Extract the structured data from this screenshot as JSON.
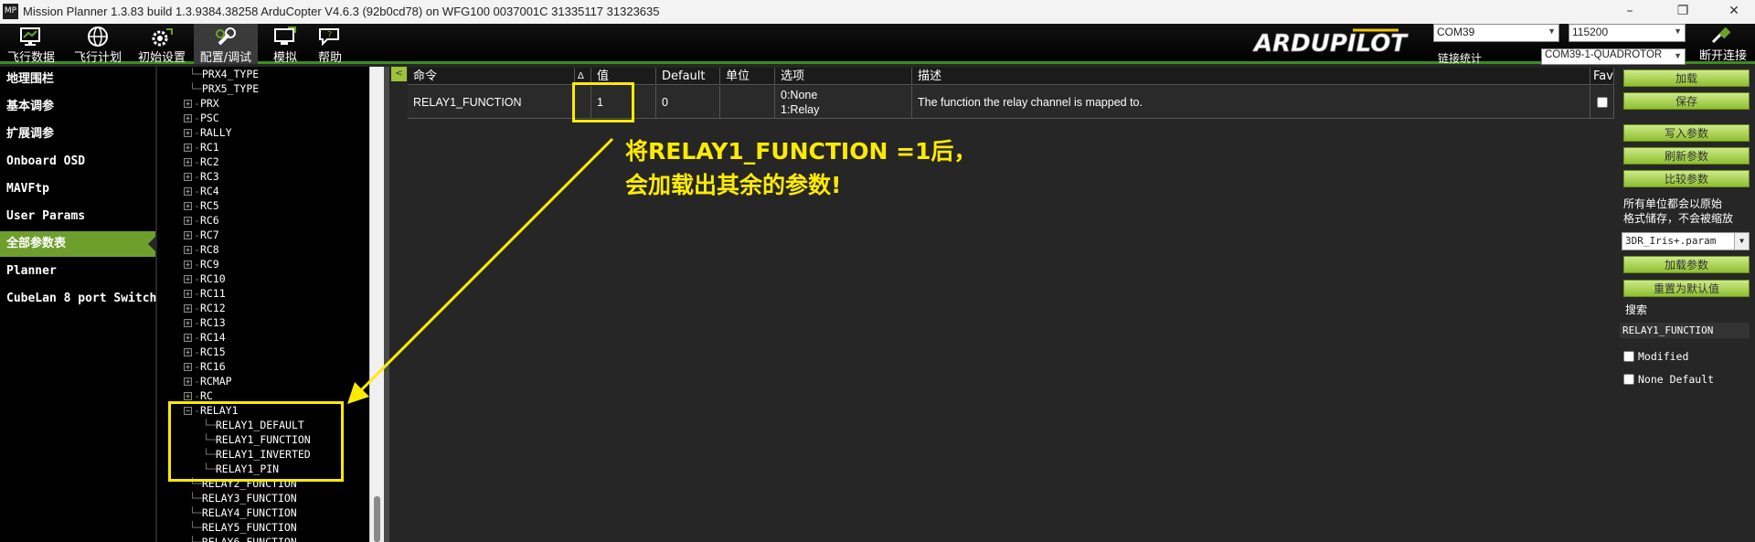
{
  "window": {
    "title": "Mission Planner 1.3.83 build 1.3.9384.38258 ArduCopter V4.6.3 (92b0cd78) on WFG100 0037001C 31335117 31323635",
    "minimize": "–",
    "maximize": "❐",
    "close": "✕"
  },
  "toolbar": {
    "buttons": [
      {
        "label": "飞行数据"
      },
      {
        "label": "飞行计划"
      },
      {
        "label": "初始设置"
      },
      {
        "label": "配置/调试"
      },
      {
        "label": "模拟"
      },
      {
        "label": "帮助"
      }
    ],
    "logo": "ARDUPILOT",
    "port": "COM39",
    "baud": "115200",
    "link_stats": "链接统计",
    "vehicle": "COM39-1-QUADROTOR",
    "disconnect": "断开连接"
  },
  "colors": {
    "accent": "#6e9e2b",
    "annotation": "#ffeb00"
  },
  "sidebar": {
    "items": [
      {
        "label": "地理围栏"
      },
      {
        "label": "基本调参"
      },
      {
        "label": "扩展调参"
      },
      {
        "label": "Onboard OSD"
      },
      {
        "label": "MAVFtp"
      },
      {
        "label": "User Params"
      },
      {
        "label": "全部参数表"
      },
      {
        "label": "Planner"
      },
      {
        "label": "CubeLan 8 port Switch"
      }
    ],
    "active_index": 6
  },
  "tree": {
    "rows": [
      {
        "text": "PRX4_TYPE",
        "kind": "leaf"
      },
      {
        "text": "PRX5_TYPE",
        "kind": "leaf"
      },
      {
        "text": "PRX",
        "kind": "group"
      },
      {
        "text": "PSC",
        "kind": "group"
      },
      {
        "text": "RALLY",
        "kind": "group"
      },
      {
        "text": "RC1",
        "kind": "group"
      },
      {
        "text": "RC2",
        "kind": "group"
      },
      {
        "text": "RC3",
        "kind": "group"
      },
      {
        "text": "RC4",
        "kind": "group"
      },
      {
        "text": "RC5",
        "kind": "group"
      },
      {
        "text": "RC6",
        "kind": "group"
      },
      {
        "text": "RC7",
        "kind": "group"
      },
      {
        "text": "RC8",
        "kind": "group"
      },
      {
        "text": "RC9",
        "kind": "group"
      },
      {
        "text": "RC10",
        "kind": "group"
      },
      {
        "text": "RC11",
        "kind": "group"
      },
      {
        "text": "RC12",
        "kind": "group"
      },
      {
        "text": "RC13",
        "kind": "group"
      },
      {
        "text": "RC14",
        "kind": "group"
      },
      {
        "text": "RC15",
        "kind": "group"
      },
      {
        "text": "RC16",
        "kind": "group"
      },
      {
        "text": "RCMAP",
        "kind": "group"
      },
      {
        "text": "RC",
        "kind": "group"
      },
      {
        "text": "RELAY1",
        "kind": "open"
      },
      {
        "text": "RELAY1_DEFAULT",
        "kind": "child"
      },
      {
        "text": "RELAY1_FUNCTION",
        "kind": "child"
      },
      {
        "text": "RELAY1_INVERTED",
        "kind": "child"
      },
      {
        "text": "RELAY1_PIN",
        "kind": "child"
      },
      {
        "text": "RELAY2_FUNCTION",
        "kind": "leaf"
      },
      {
        "text": "RELAY3_FUNCTION",
        "kind": "leaf"
      },
      {
        "text": "RELAY4_FUNCTION",
        "kind": "leaf"
      },
      {
        "text": "RELAY5_FUNCTION",
        "kind": "leaf"
      },
      {
        "text": "RELAY6_FUNCTION",
        "kind": "leaf"
      }
    ]
  },
  "grid": {
    "collapse": "<",
    "columns": [
      "命令",
      "Δ",
      "值",
      "Default",
      "单位",
      "选项",
      "描述",
      "Fav"
    ],
    "row": {
      "command": "RELAY1_FUNCTION",
      "value": "1",
      "default": "0",
      "unit": "",
      "options": [
        "0:None",
        "1:Relay"
      ],
      "description": "The function the relay channel is mapped to."
    }
  },
  "right_panel": {
    "load": "加载",
    "save": "保存",
    "write": "写入参数",
    "refresh": "刷新参数",
    "compare": "比较参数",
    "note_line1": "所有单位都会以原始",
    "note_line2": "格式储存，不会被缩放",
    "param_file": "3DR_Iris+.param",
    "load_params": "加载参数",
    "reset_default": "重置为默认值",
    "search_label": "搜索",
    "search_value": "RELAY1_FUNCTION",
    "modified": "Modified",
    "none_default": "None Default"
  },
  "annotation": {
    "line1": "将RELAY1_FUNCTION =1后，",
    "line2": "会加载出其余的参数!"
  }
}
